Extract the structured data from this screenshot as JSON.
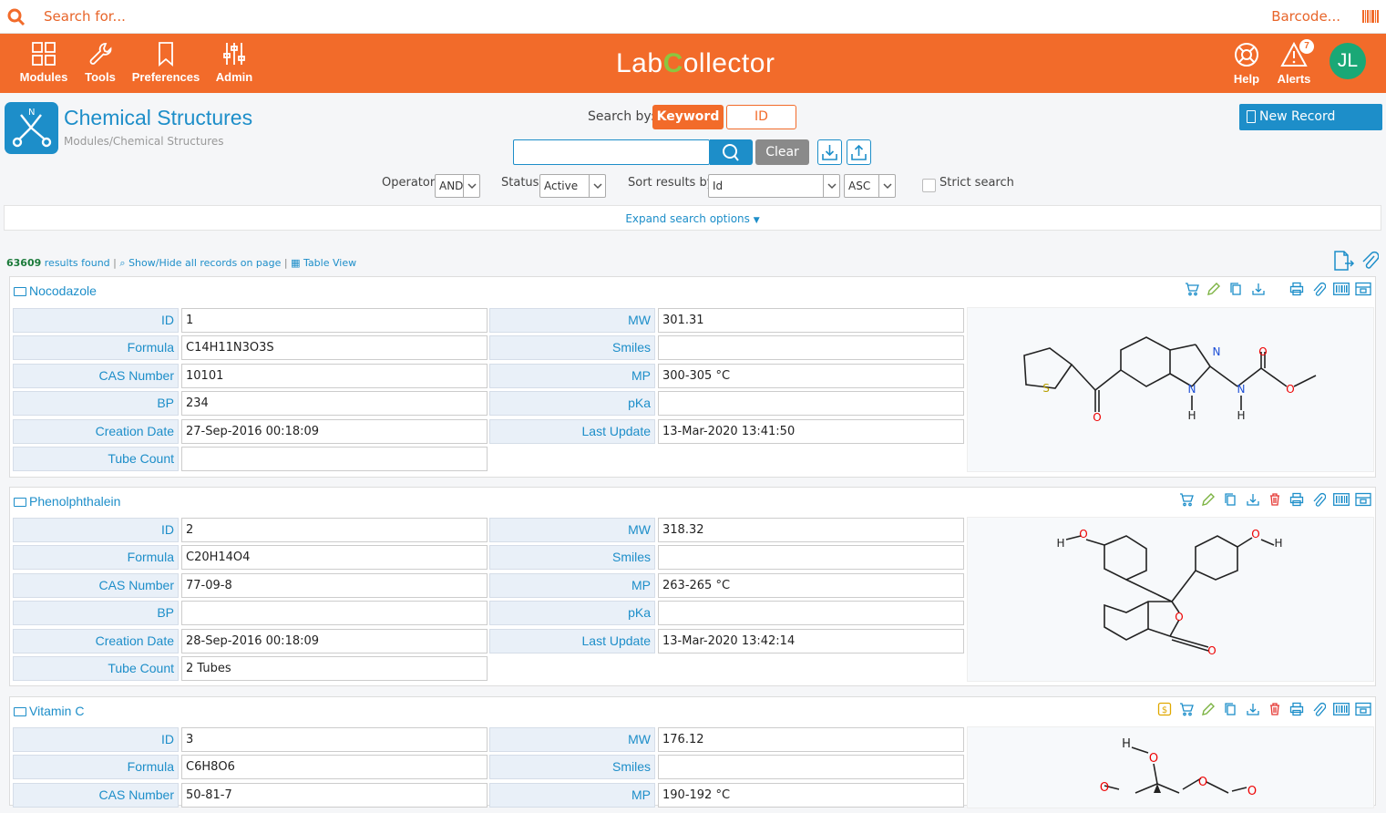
{
  "topbar": {
    "search_placeholder": "Search for...",
    "barcode_label": "Barcode..."
  },
  "nav": {
    "items": [
      {
        "label": "Modules",
        "icon": "grid-icon"
      },
      {
        "label": "Tools",
        "icon": "wrench-icon"
      },
      {
        "label": "Preferences",
        "icon": "bookmark-icon"
      },
      {
        "label": "Admin",
        "icon": "sliders-icon"
      }
    ],
    "logo_left": "Lab",
    "logo_c": "C",
    "logo_right": "ollector",
    "help_label": "Help",
    "alerts_label": "Alerts",
    "alerts_count": "7",
    "user_initials": "JL"
  },
  "module": {
    "title": "Chemical Structures",
    "breadcrumb": "Modules/Chemical Structures"
  },
  "search": {
    "search_by_label": "Search by:",
    "keyword_label": "Keyword",
    "id_label": "ID",
    "clear_label": "Clear",
    "new_record_label": "New Record",
    "operator_label": "Operator:",
    "operator_value": "AND",
    "status_label": "Status:",
    "status_value": "Active",
    "sort_label": "Sort results by:",
    "sort_value": "Id",
    "order_value": "ASC",
    "strict_label": "Strict search",
    "expand_label": "Expand search options"
  },
  "results": {
    "count": "63609",
    "found_text": "results found",
    "show_hide": "Show/Hide all records on page",
    "table_view": "Table View"
  },
  "field_labels": {
    "id": "ID",
    "formula": "Formula",
    "cas": "CAS Number",
    "bp": "BP",
    "created": "Creation Date",
    "tubes": "Tube Count",
    "mw": "MW",
    "smiles": "Smiles",
    "mp": "MP",
    "pka": "pKa",
    "updated": "Last Update"
  },
  "records": [
    {
      "name": "Nocodazole",
      "id": "1",
      "formula": "C14H11N3O3S",
      "cas": "10101",
      "bp": "234",
      "created": "27-Sep-2016 00:18:09",
      "tubes": "",
      "mw": "301.31",
      "smiles": "",
      "mp": "300-305 °C",
      "pka": "",
      "updated": "13-Mar-2020 13:41:50"
    },
    {
      "name": "Phenolphthalein",
      "id": "2",
      "formula": "C20H14O4",
      "cas": "77-09-8",
      "bp": "",
      "created": "28-Sep-2016 00:18:09",
      "tubes": "2 Tubes",
      "mw": "318.32",
      "smiles": "",
      "mp": "263-265 °C",
      "pka": "",
      "updated": "13-Mar-2020 13:42:14"
    },
    {
      "name": "Vitamin C",
      "id": "3",
      "formula": "C6H8O6",
      "cas": "50-81-7",
      "mw": "176.12",
      "smiles": "",
      "mp": "190-192 °C"
    }
  ],
  "structure_atoms": {
    "nocodazole": [
      "S",
      "O",
      "N",
      "N",
      "H",
      "N",
      "H",
      "O",
      "O"
    ],
    "phenolphthalein": [
      "H",
      "O",
      "O",
      "H",
      "O",
      "O"
    ],
    "vitaminc": [
      "H",
      "O",
      "O",
      "O",
      "O"
    ]
  },
  "colors": {
    "brand_orange": "#f26b2a",
    "brand_blue": "#1d8ec9",
    "logo_green": "#8cc63f",
    "avatar_green": "#1aa876"
  }
}
